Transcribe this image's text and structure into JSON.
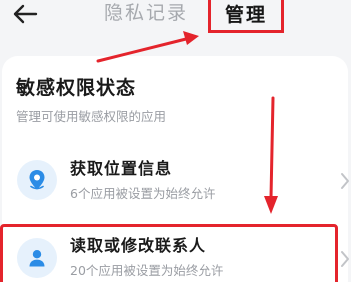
{
  "header": {
    "back_icon": "arrow-left-icon",
    "tab_privacy_label": "隐私记录",
    "tab_manage_label": "管理"
  },
  "section": {
    "title": "敏感权限状态",
    "description": "管理可使用敏感权限的应用"
  },
  "permissions": [
    {
      "title": "获取位置信息",
      "subtitle": "6个应用被设置为始终允许",
      "icon": "location-pin-icon"
    },
    {
      "title": "读取或修改联系人",
      "subtitle": "20个应用被设置为始终允许",
      "icon": "person-icon"
    }
  ],
  "colors": {
    "highlight": "#e4242c",
    "icon_blue": "#2b8ce6",
    "icon_bg": "#e6f1fc"
  }
}
